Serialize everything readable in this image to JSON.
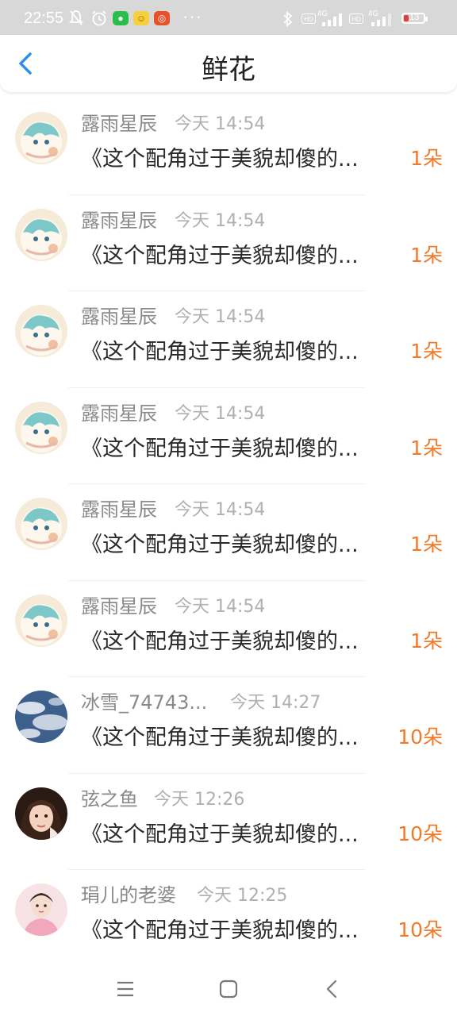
{
  "status_bar": {
    "time": "22:55",
    "signal_1_label": "4G",
    "signal_2_label": "4G",
    "battery": "13",
    "icons": [
      "mute-bell-icon",
      "alarm-icon",
      "wechat-icon",
      "app-icon",
      "app-icon",
      "more-icon",
      "bluetooth-icon",
      "hd-icon",
      "signal-icon",
      "hd-icon",
      "signal-icon",
      "battery-icon"
    ]
  },
  "header": {
    "title": "鲜花",
    "back_icon": "chevron-left-icon"
  },
  "colors": {
    "accent_blue": "#2d8ef0",
    "count_orange": "#f07a28",
    "status_bg": "#d8d8d8"
  },
  "messages": [
    {
      "name": "露雨星辰",
      "time": "今天 14:54",
      "text": "《这个配角过于美貌却傻的...",
      "count": "1朵",
      "avatar": "anime"
    },
    {
      "name": "露雨星辰",
      "time": "今天 14:54",
      "text": "《这个配角过于美貌却傻的...",
      "count": "1朵",
      "avatar": "anime"
    },
    {
      "name": "露雨星辰",
      "time": "今天 14:54",
      "text": "《这个配角过于美貌却傻的...",
      "count": "1朵",
      "avatar": "anime"
    },
    {
      "name": "露雨星辰",
      "time": "今天 14:54",
      "text": "《这个配角过于美貌却傻的...",
      "count": "1朵",
      "avatar": "anime"
    },
    {
      "name": "露雨星辰",
      "time": "今天 14:54",
      "text": "《这个配角过于美貌却傻的...",
      "count": "1朵",
      "avatar": "anime"
    },
    {
      "name": "露雨星辰",
      "time": "今天 14:54",
      "text": "《这个配角过于美貌却傻的...",
      "count": "1朵",
      "avatar": "anime"
    },
    {
      "name": "冰雪_74743...",
      "time": "今天 14:27",
      "text": "《这个配角过于美貌却傻的...",
      "count": "10朵",
      "avatar": "sky"
    },
    {
      "name": "弦之鱼",
      "time": "今天 12:26",
      "text": "《这个配角过于美貌却傻的...",
      "count": "10朵",
      "avatar": "girl"
    },
    {
      "name": "琄儿的老婆",
      "time": "今天 12:25",
      "text": "《这个配角过于美貌却傻的...",
      "count": "10朵",
      "avatar": "portrait"
    }
  ],
  "system_nav": [
    "menu-icon",
    "home-icon",
    "back-icon"
  ]
}
